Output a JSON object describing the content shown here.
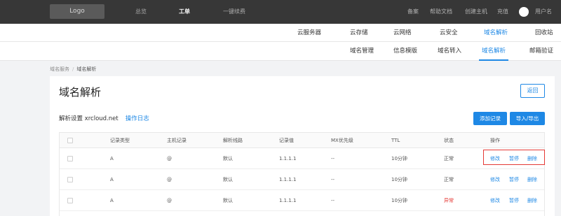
{
  "topbar": {
    "logo": "Logo",
    "nav": [
      "总览",
      "工单",
      "一键续费"
    ],
    "links": [
      "备案",
      "帮助文档",
      "创建主机",
      "充值"
    ],
    "username": "用户名"
  },
  "product_nav": [
    "云服务器",
    "云存储",
    "云网络",
    "云安全",
    "域名解析",
    "回收站"
  ],
  "sub_nav": [
    "域名管理",
    "信息模版",
    "域名转入",
    "域名解析",
    "邮箱验证"
  ],
  "breadcrumb": [
    "域名服务",
    "域名解析"
  ],
  "page": {
    "title": "域名解析",
    "back": "返回",
    "domain_label": "解析设置 xrcloud.net",
    "log_link": "操作日志",
    "add_record": "添加记录",
    "import_export": "导入/导出"
  },
  "table": {
    "headers": [
      "记录类型",
      "主机记录",
      "解析线路",
      "记录值",
      "MX优先级",
      "TTL",
      "状态",
      "操作"
    ],
    "rows": [
      {
        "type": "A",
        "host": "@",
        "line": "默认",
        "value": "1.1.1.1",
        "mx": "--",
        "ttl": "10分钟",
        "status": "正常",
        "actions": [
          "修改",
          "暂停",
          "删除"
        ]
      },
      {
        "type": "A",
        "host": "@",
        "line": "默认",
        "value": "1.1.1.1",
        "mx": "--",
        "ttl": "10分钟",
        "status": "正常",
        "actions": [
          "修改",
          "暂停",
          "删除"
        ]
      },
      {
        "type": "A",
        "host": "@",
        "line": "默认",
        "value": "1.1.1.1",
        "mx": "--",
        "ttl": "10分钟",
        "status": "异常",
        "actions": [
          "修改",
          "暂停",
          "删除"
        ]
      }
    ]
  },
  "colors": {
    "accent": "#1e88e5",
    "topbar": "#373737",
    "error": "#e53935"
  }
}
